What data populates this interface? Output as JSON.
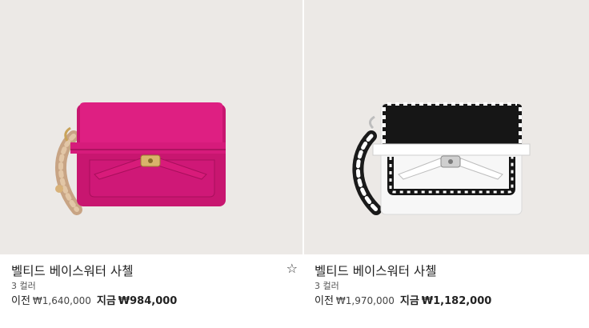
{
  "products": [
    {
      "name": "벨티드 베이스워터 사첼",
      "colors": "3 컬러",
      "was_label": "이전",
      "was_price": "₩1,640,000",
      "now_label": "지금",
      "now_price": "₩984,000",
      "image": "pink-satchel-bag",
      "bag_color": "#d81b7a",
      "favorite_icon": "star-outline-icon"
    },
    {
      "name": "벨티드 베이스워터 사첼",
      "colors": "3 컬러",
      "was_label": "이전",
      "was_price": "₩1,970,000",
      "now_label": "지금",
      "now_price": "₩1,182,000",
      "image": "black-white-satchel-bag"
    }
  ],
  "favorite_glyph": "☆"
}
